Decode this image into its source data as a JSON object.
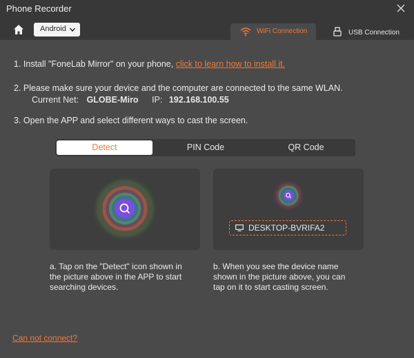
{
  "app": {
    "title": "Phone Recorder"
  },
  "toolbar": {
    "os_select": "Android",
    "tabs": [
      {
        "label": "WiFi Connection",
        "active": true
      },
      {
        "label": "USB Connection",
        "active": false
      }
    ]
  },
  "steps": {
    "step1_text": "1. Install \"FoneLab Mirror\" on your phone, ",
    "step1_link": "click to learn how to install it.",
    "step2_text": "2. Please make sure your device and the computer are connected to the same WLAN.",
    "net_label": "Current Net:",
    "net_value": "GLOBE-Miro",
    "ip_label": "IP:",
    "ip_value": "192.168.100.55",
    "step3_text": "3. Open the APP and select different ways to cast the screen."
  },
  "modes": [
    {
      "label": "Detect",
      "active": true
    },
    {
      "label": "PIN Code",
      "active": false
    },
    {
      "label": "QR Code",
      "active": false
    }
  ],
  "cards": {
    "device_name": "DESKTOP-BVRIFA2",
    "desc_a": "a. Tap on the \"Detect\" icon shown in the picture above in the APP to start searching devices.",
    "desc_b": "b. When you see the device name shown in the picture above, you can tap on it to start casting screen."
  },
  "footer": {
    "cannot_connect": "Can not connect?"
  },
  "colors": {
    "accent": "#ee7a3c",
    "background": "#4a4a4a",
    "titlebar": "#383838",
    "detect_icon": "#7b4de0"
  }
}
